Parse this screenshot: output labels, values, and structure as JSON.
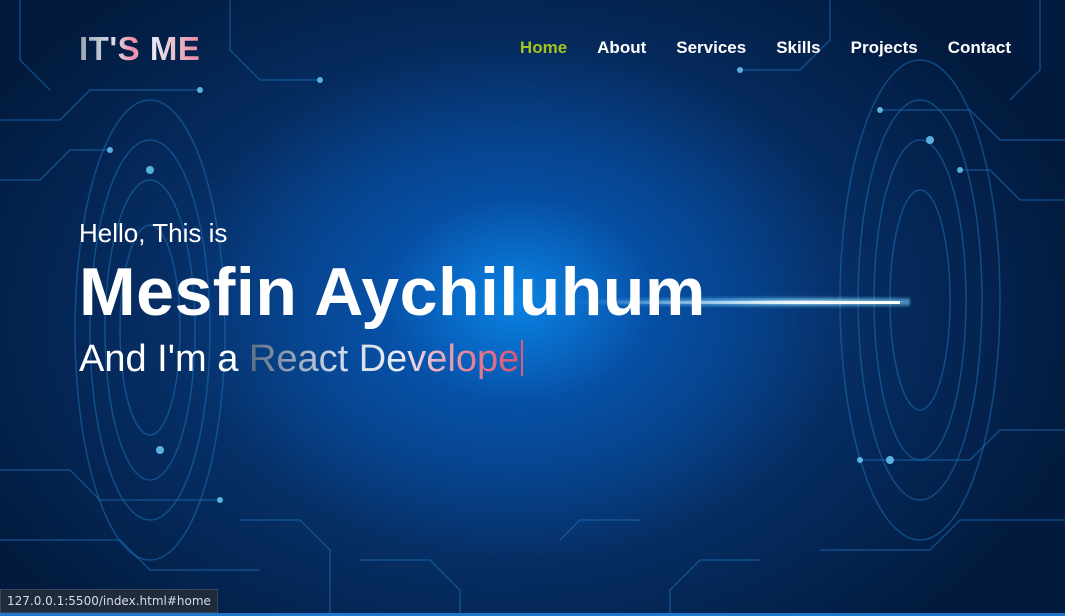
{
  "header": {
    "logo": "IT'S ME",
    "nav": [
      {
        "label": "Home",
        "active": true
      },
      {
        "label": "About",
        "active": false
      },
      {
        "label": "Services",
        "active": false
      },
      {
        "label": "Skills",
        "active": false
      },
      {
        "label": "Projects",
        "active": false
      },
      {
        "label": "Contact",
        "active": false
      }
    ]
  },
  "hero": {
    "greeting": "Hello, This is",
    "name": "Mesfin Aychiluhum",
    "role_prefix": "And I'm a",
    "role_typed": "React Develope"
  },
  "status_bar": {
    "url": "127.0.0.1:5500/index.html#home"
  },
  "colors": {
    "nav_active": "#a6c21f",
    "nav_default": "#ffffff",
    "background": "#062f66",
    "accent_pink": "#e7869e"
  }
}
